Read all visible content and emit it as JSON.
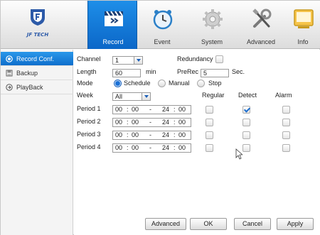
{
  "logo": {
    "brand": "JF TECH"
  },
  "tabs": [
    {
      "label": "Record",
      "icon": "record-clapper-icon",
      "active": true
    },
    {
      "label": "Event",
      "icon": "alarm-clock-icon"
    },
    {
      "label": "System",
      "icon": "gear-icon"
    },
    {
      "label": "Advanced",
      "icon": "tools-icon"
    },
    {
      "label": "Info",
      "icon": "monitor-icon"
    }
  ],
  "sidebar": {
    "items": [
      {
        "label": "Record Conf.",
        "icon": "record-icon",
        "active": true
      },
      {
        "label": "Backup",
        "icon": "backup-icon"
      },
      {
        "label": "PlayBack",
        "icon": "playback-icon"
      }
    ]
  },
  "form": {
    "channel_label": "Channel",
    "channel_value": "1",
    "redundancy_label": "Redundancy",
    "length_label": "Length",
    "length_value": "60",
    "length_unit": "min",
    "prerec_label": "PreRec",
    "prerec_value": "5",
    "prerec_unit": "Sec.",
    "mode_label": "Mode",
    "mode_options": [
      "Schedule",
      "Manual",
      "Stop"
    ],
    "mode_selected": "Schedule",
    "week_label": "Week",
    "week_value": "All",
    "col_regular": "Regular",
    "col_detect": "Detect",
    "col_alarm": "Alarm"
  },
  "periods": [
    {
      "label": "Period 1",
      "start_h": "00",
      "start_m": "00",
      "end_h": "24",
      "end_m": "00",
      "regular": false,
      "detect": true,
      "alarm": false
    },
    {
      "label": "Period 2",
      "start_h": "00",
      "start_m": "00",
      "end_h": "24",
      "end_m": "00",
      "regular": false,
      "detect": false,
      "alarm": false
    },
    {
      "label": "Period 3",
      "start_h": "00",
      "start_m": "00",
      "end_h": "24",
      "end_m": "00",
      "regular": false,
      "detect": false,
      "alarm": false
    },
    {
      "label": "Period 4",
      "start_h": "00",
      "start_m": "00",
      "end_h": "24",
      "end_m": "00",
      "regular": false,
      "detect": false,
      "alarm": false
    }
  ],
  "buttons": {
    "advanced": "Advanced",
    "ok": "OK",
    "cancel": "Cancel",
    "apply": "Apply"
  },
  "colors": {
    "accent": "#0b67c8",
    "check": "#1d6fcf"
  }
}
